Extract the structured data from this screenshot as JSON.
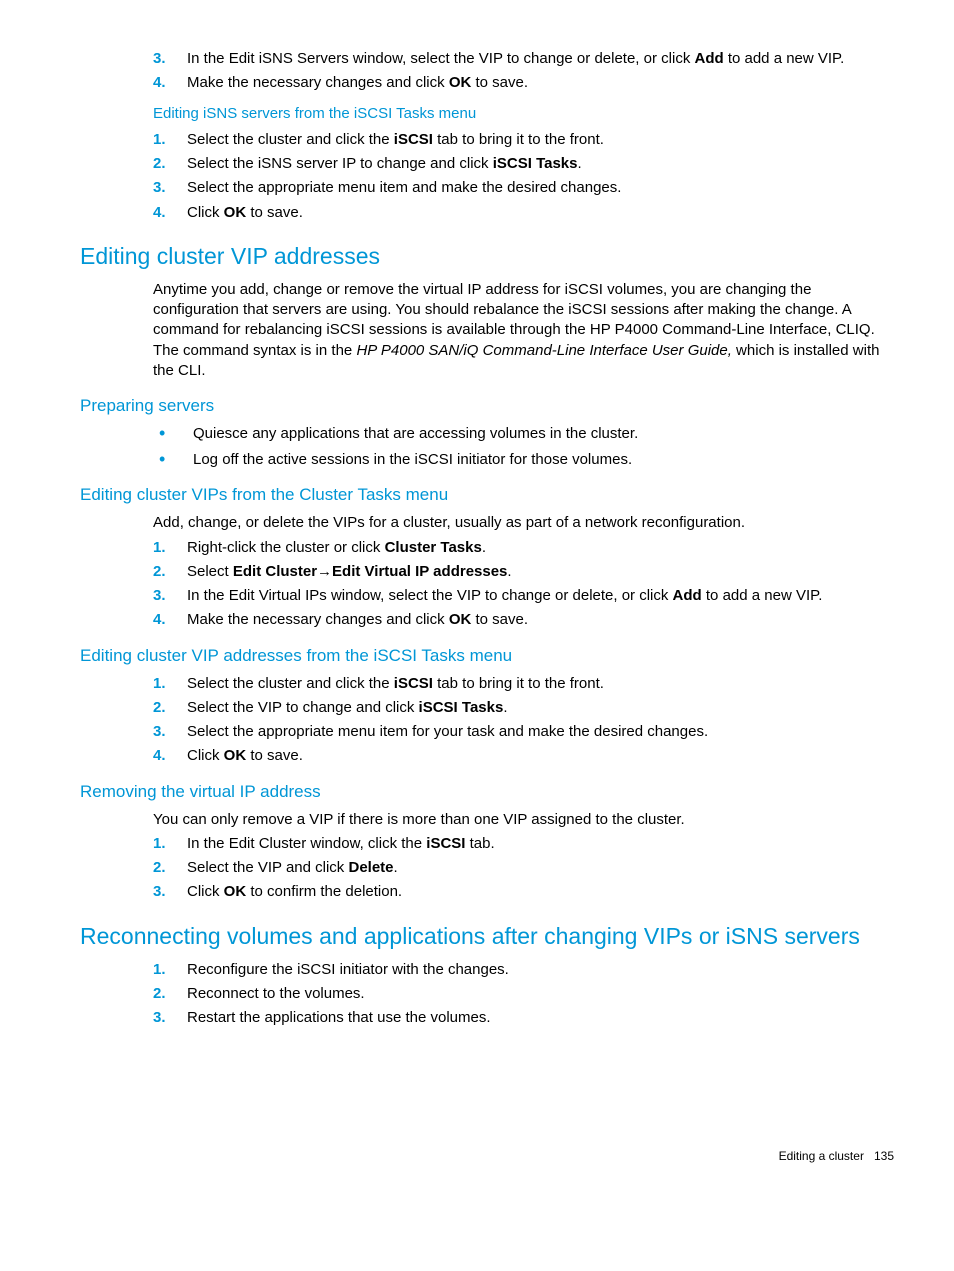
{
  "top_continued": {
    "steps": [
      {
        "n": "3.",
        "pre": "In the Edit iSNS Servers window, select the VIP to change or delete, or click ",
        "b": "Add",
        "post": " to add a new VIP."
      },
      {
        "n": "4.",
        "pre": "Make the necessary changes and click ",
        "b": "OK",
        "post": " to save."
      }
    ]
  },
  "sec_isns_tasks": {
    "title": "Editing iSNS servers from the iSCSI Tasks menu",
    "steps": [
      {
        "n": "1.",
        "pre": "Select the cluster and click the ",
        "b": "iSCSI",
        "post": " tab to bring it to the front."
      },
      {
        "n": "2.",
        "pre": "Select the iSNS server IP to change and click ",
        "b": "iSCSI Tasks",
        "post": "."
      },
      {
        "n": "3.",
        "pre": "Select the appropriate menu item and make the desired changes.",
        "b": "",
        "post": ""
      },
      {
        "n": "4.",
        "pre": "Click ",
        "b": "OK",
        "post": " to save."
      }
    ]
  },
  "sec_edit_vip": {
    "title": "Editing cluster VIP addresses",
    "para_pre": "Anytime you add, change or remove the virtual IP address for iSCSI volumes, you are changing the configuration that servers are using. You should rebalance the iSCSI sessions after making the change. A command for rebalancing iSCSI sessions is available through the HP P4000 Command-Line Interface, CLIQ. The command syntax is in the ",
    "para_italic": "HP P4000 SAN/iQ Command-Line Interface User Guide,",
    "para_post": " which is installed with the CLI."
  },
  "sec_prep": {
    "title": "Preparing servers",
    "bullets": [
      "Quiesce any applications that are accessing volumes in the cluster.",
      "Log off the active sessions in the iSCSI initiator for those volumes."
    ]
  },
  "sec_cluster_tasks": {
    "title": "Editing cluster VIPs from the Cluster Tasks menu",
    "para": "Add, change, or delete the VIPs for a cluster, usually as part of a network reconfiguration.",
    "step1": {
      "n": "1.",
      "pre": "Right-click the cluster or click ",
      "b": "Cluster Tasks",
      "post": "."
    },
    "step2": {
      "n": "2.",
      "pre": "Select ",
      "b1": "Edit Cluster",
      "arrow": "→",
      "b2": "Edit Virtual IP addresses",
      "post": "."
    },
    "step3": {
      "n": "3.",
      "pre": "In the Edit Virtual IPs window, select the VIP to change or delete, or click ",
      "b": "Add",
      "post": " to add a new VIP."
    },
    "step4": {
      "n": "4.",
      "pre": "Make the necessary changes and click ",
      "b": "OK",
      "post": " to save."
    }
  },
  "sec_iscsi_tasks2": {
    "title": "Editing cluster VIP addresses from the iSCSI Tasks menu",
    "steps": [
      {
        "n": "1.",
        "pre": "Select the cluster and click the ",
        "b": "iSCSI",
        "post": " tab to bring it to the front."
      },
      {
        "n": "2.",
        "pre": "Select the VIP to change and click ",
        "b": "iSCSI Tasks",
        "post": "."
      },
      {
        "n": "3.",
        "pre": "Select the appropriate menu item for your task and make the desired changes.",
        "b": "",
        "post": ""
      },
      {
        "n": "4.",
        "pre": "Click ",
        "b": "OK",
        "post": " to save."
      }
    ]
  },
  "sec_remove": {
    "title": "Removing the virtual IP address",
    "para": "You can only remove a VIP if there is more than one VIP assigned to the cluster.",
    "steps": [
      {
        "n": "1.",
        "pre": "In the Edit Cluster window, click the ",
        "b": "iSCSI",
        "post": " tab."
      },
      {
        "n": "2.",
        "pre": "Select the VIP and click ",
        "b": "Delete",
        "post": "."
      },
      {
        "n": "3.",
        "pre": "Click ",
        "b": "OK",
        "post": " to confirm the deletion."
      }
    ]
  },
  "sec_reconnect": {
    "title": "Reconnecting volumes and applications after changing VIPs or iSNS servers",
    "steps": [
      {
        "n": "1.",
        "txt": "Reconfigure the iSCSI initiator with the changes."
      },
      {
        "n": "2.",
        "txt": "Reconnect to the volumes."
      },
      {
        "n": "3.",
        "txt": "Restart the applications that use the volumes."
      }
    ]
  },
  "footer": {
    "label": "Editing a cluster",
    "page": "135"
  }
}
